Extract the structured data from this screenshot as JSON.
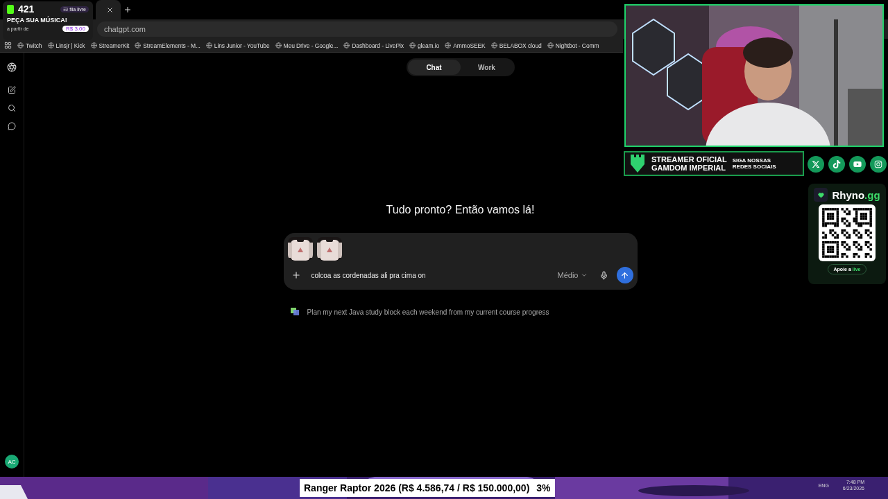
{
  "stream_widget": {
    "count": "421",
    "queue_badge": "fila livre",
    "title": "PEÇA SUA MÚSICA!",
    "price_label": "a partir de",
    "price": "R$ 3.00"
  },
  "browser": {
    "address": "chatgpt.com",
    "bookmarks": [
      {
        "label": "Twitch"
      },
      {
        "label": "Linsjr | Kick"
      },
      {
        "label": "StreamerKit"
      },
      {
        "label": "StreamElements - M..."
      },
      {
        "label": "Lins Junior - YouTube"
      },
      {
        "label": "Meu Drive - Google..."
      },
      {
        "label": "Dashboard - LivePix"
      },
      {
        "label": "gleam.io"
      },
      {
        "label": "AmmoSEEK"
      },
      {
        "label": "BELABOX cloud"
      },
      {
        "label": "Nightbot - Comm"
      }
    ]
  },
  "mode_tabs": [
    {
      "label": "Chat",
      "selected": true
    },
    {
      "label": "Work",
      "selected": false
    }
  ],
  "heading": "Tudo pronto? Então vamos lá!",
  "composer": {
    "value": "colcoa as cordenadas ali pra cima on",
    "model": "Médio"
  },
  "suggestion": "Plan my next Java study block each weekend from my current course progress",
  "avatar": "AC",
  "stream_overlay": {
    "sponsor_line1": "STREAMER OFICIAL",
    "sponsor_line2": "GAMDOM IMPERIAL",
    "social_line1": "SIGA NOSSAS",
    "social_line2": "REDES SOCIAIS",
    "brand": "Rhyno",
    "brand_suffix": ".gg",
    "support_prefix": "Apoie a",
    "support_word": "live",
    "goal_text": "Ranger Raptor 2026 (R$ 4.586,74 / R$ 150.000,00)",
    "goal_percent": "3%"
  },
  "taskbar": {
    "language": "ENG",
    "time": "7:48 PM",
    "date": "6/23/2026"
  }
}
